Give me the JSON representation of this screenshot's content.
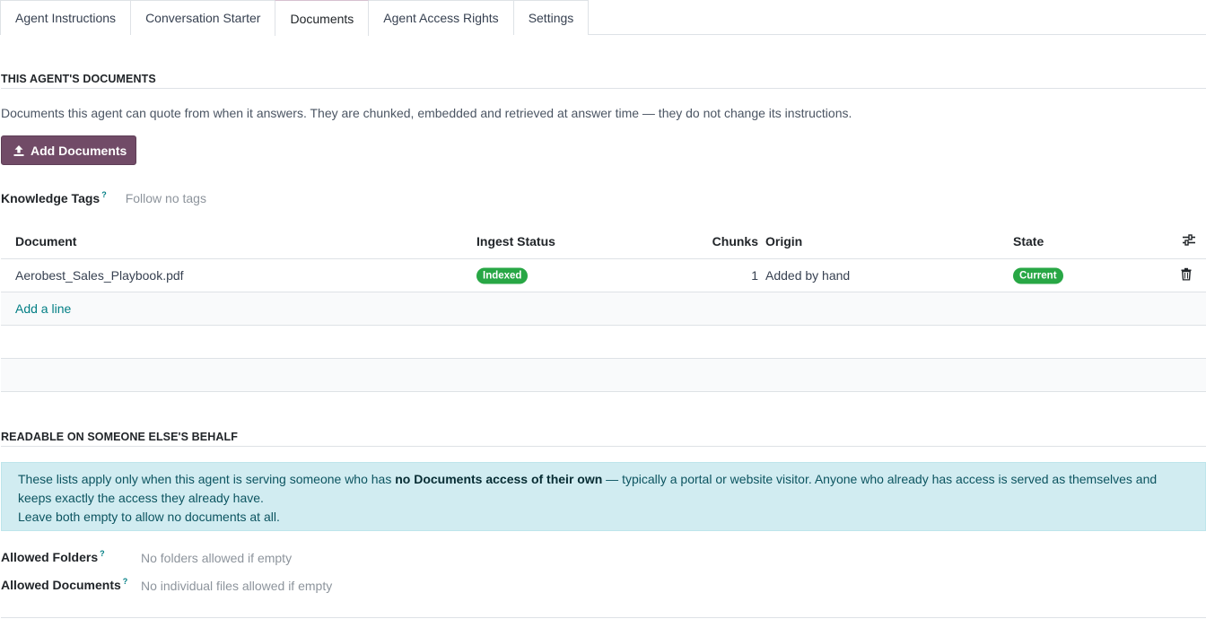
{
  "tabs": [
    {
      "label": "Agent Instructions"
    },
    {
      "label": "Conversation Starter"
    },
    {
      "label": "Documents"
    },
    {
      "label": "Agent Access Rights"
    },
    {
      "label": "Settings"
    }
  ],
  "documents_section": {
    "title": "THIS AGENT'S DOCUMENTS",
    "description": "Documents this agent can quote from when it answers. They are chunked, embedded and retrieved at answer time — they do not change its instructions.",
    "add_button_label": "Add Documents",
    "knowledge_tags_label": "Knowledge Tags",
    "knowledge_tags_help": "?",
    "knowledge_tags_placeholder": "Follow no tags"
  },
  "table": {
    "columns": {
      "document": "Document",
      "ingest_status": "Ingest Status",
      "chunks": "Chunks",
      "origin": "Origin",
      "state": "State"
    },
    "rows": [
      {
        "document": "Aerobest_Sales_Playbook.pdf",
        "ingest_status": "Indexed",
        "chunks": "1",
        "origin": "Added by hand",
        "state": "Current"
      }
    ],
    "add_line_label": "Add a line"
  },
  "readable_section": {
    "title": "READABLE ON SOMEONE ELSE'S BEHALF",
    "info_part1": "These lists apply only when this agent is serving someone who has ",
    "info_bold": "no Documents access of their own",
    "info_part2": " — typically a portal or website visitor. Anyone who already has access is served as themselves and keeps exactly the access they already have.",
    "info_line2": "Leave both empty to allow no documents at all.",
    "allowed_folders_label": "Allowed Folders",
    "allowed_folders_help": "?",
    "allowed_folders_placeholder": "No folders allowed if empty",
    "allowed_documents_label": "Allowed Documents",
    "allowed_documents_help": "?",
    "allowed_documents_placeholder": "No individual files allowed if empty"
  },
  "colors": {
    "primary": "#714b67",
    "success_badge": "#28a745",
    "link": "#017e84",
    "info_bg": "#d1ecf1"
  }
}
